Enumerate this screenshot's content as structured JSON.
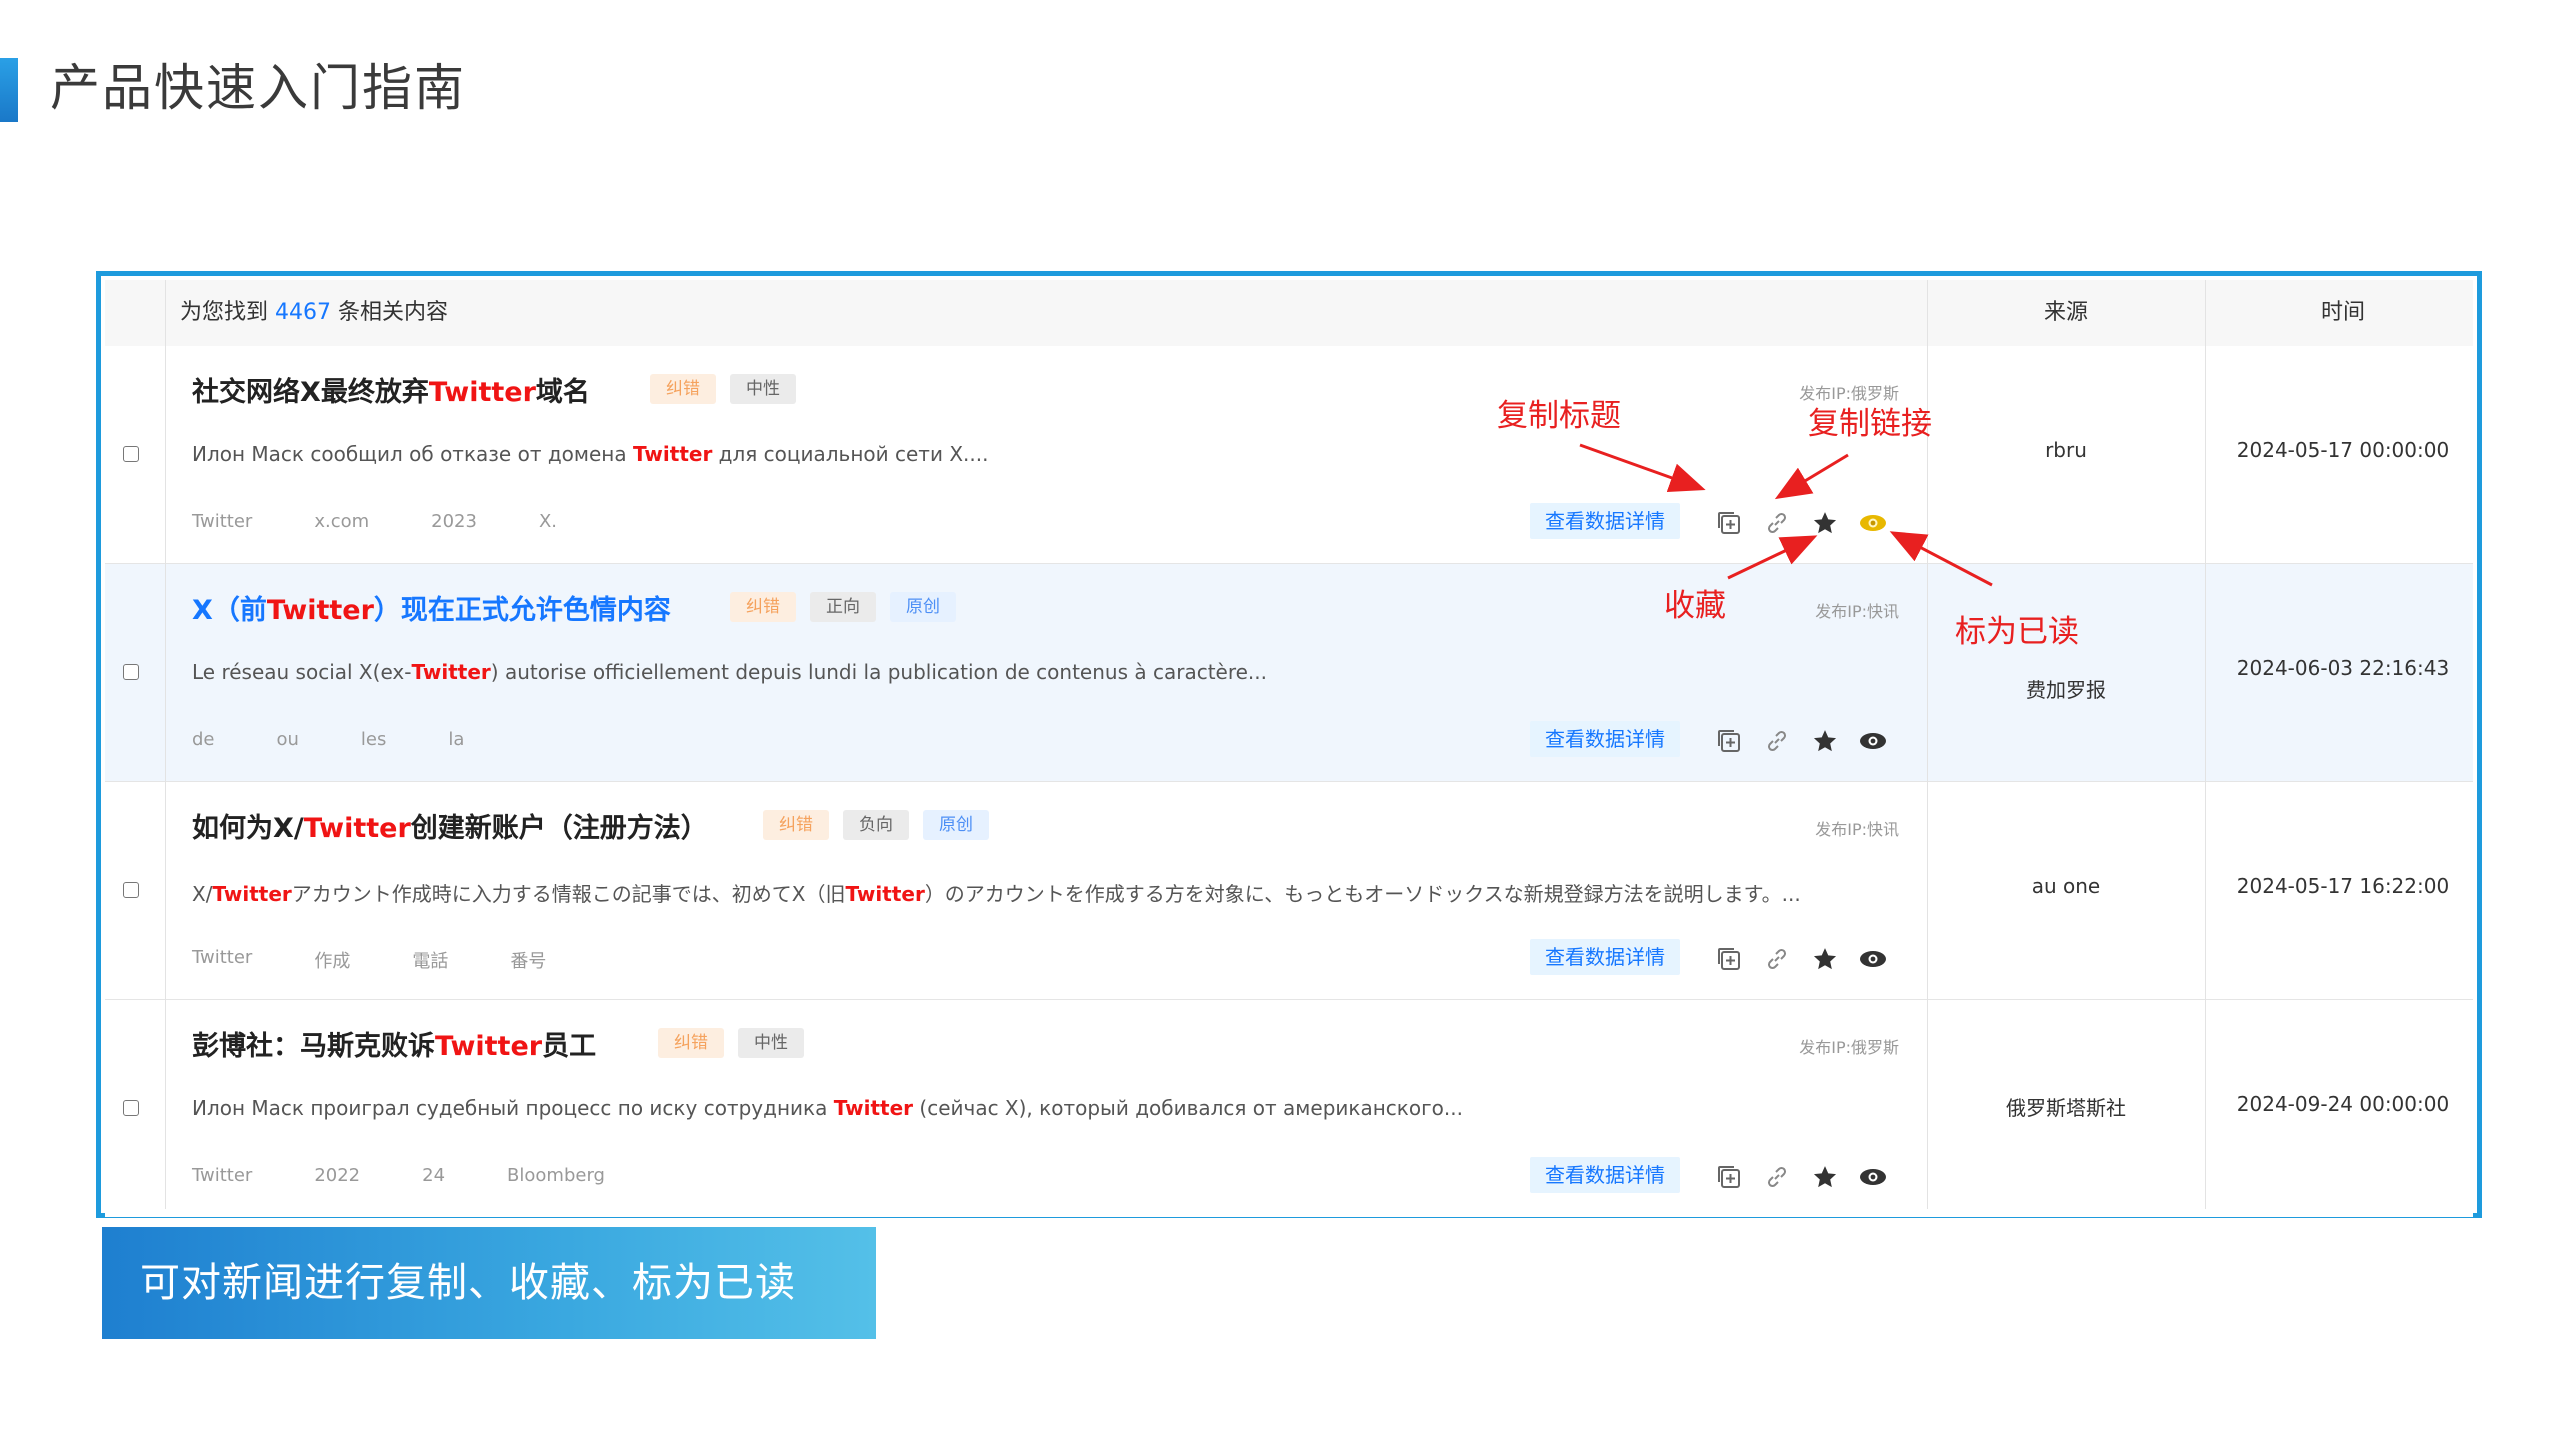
{
  "page_title": "产品快速入门指南",
  "header": {
    "found_prefix": "为您找到",
    "found_count": "4467",
    "found_suffix": "条相关内容",
    "col_source": "来源",
    "col_time": "时间"
  },
  "rows": [
    {
      "title_a": "社交网络X最终放弃",
      "title_hl": "Twitter",
      "title_b": "域名",
      "tags": [
        "纠错",
        "中性"
      ],
      "ip": "发布IP:俄罗斯",
      "summary_a": "Илон Маск сообщил об отказе от домена ",
      "summary_hl": "Twitter",
      "summary_b": " для социальной сети X....",
      "keywords": [
        "Twitter",
        "x.com",
        "2023",
        "X."
      ],
      "detail_btn": "查看数据详情",
      "source": "rbru",
      "time": "2024-05-17 00:00:00"
    },
    {
      "title_a": "X（前",
      "title_hl": "Twitter",
      "title_b": "）现在正式允许色情内容",
      "tags": [
        "纠错",
        "正向",
        "原创"
      ],
      "ip": "发布IP:快讯",
      "summary_a": "Le réseau social X(ex-",
      "summary_hl": "Twitter",
      "summary_b": ") autorise officiellement depuis lundi la publication de contenus à caractère...",
      "keywords": [
        "de",
        "ou",
        "les",
        "la"
      ],
      "detail_btn": "查看数据详情",
      "source": "费加罗报",
      "time": "2024-06-03 22:16:43"
    },
    {
      "title_a": "如何为X/",
      "title_hl": "Twitter",
      "title_b": "创建新账户（注册方法）",
      "tags": [
        "纠错",
        "负向",
        "原创"
      ],
      "ip": "发布IP:快讯",
      "summary_a": "X/",
      "summary_hl": "Twitter",
      "summary_b": "アカウント作成時に入力する情報この記事では、初めてX（旧",
      "summary_hl2": "Twitter",
      "summary_c": "）のアカウントを作成する方を対象に、もっともオーソドックスな新規登録方法を説明します。...",
      "keywords": [
        "Twitter",
        "作成",
        "電話",
        "番号"
      ],
      "detail_btn": "查看数据详情",
      "source": "au one",
      "time": "2024-05-17 16:22:00"
    },
    {
      "title_a": "彭博社：马斯克败诉",
      "title_hl": "Twitter",
      "title_b": "员工",
      "tags": [
        "纠错",
        "中性"
      ],
      "ip": "发布IP:俄罗斯",
      "summary_a": "Илон Маск проиграл судебный процесс по иску сотрудника ",
      "summary_hl": "Twitter",
      "summary_b": " (сейчас X), который добивался от американского...",
      "keywords": [
        "Twitter",
        "2022",
        "24",
        "Bloomberg"
      ],
      "detail_btn": "查看数据详情",
      "source": "俄罗斯塔斯社",
      "time": "2024-09-24 00:00:00"
    }
  ],
  "annotations": {
    "copy_title": "复制标题",
    "copy_link": "复制链接",
    "favorite": "收藏",
    "mark_read": "标为已读"
  },
  "banner": "可对新闻进行复制、收藏、标为已读",
  "colors": {
    "accent": "#1e9bdd",
    "highlight_red": "#f01414",
    "link_blue": "#1677ff",
    "read_marker": "#e8b800"
  },
  "icons": [
    "copy-title-icon",
    "link-icon",
    "star-icon",
    "eye-icon"
  ]
}
